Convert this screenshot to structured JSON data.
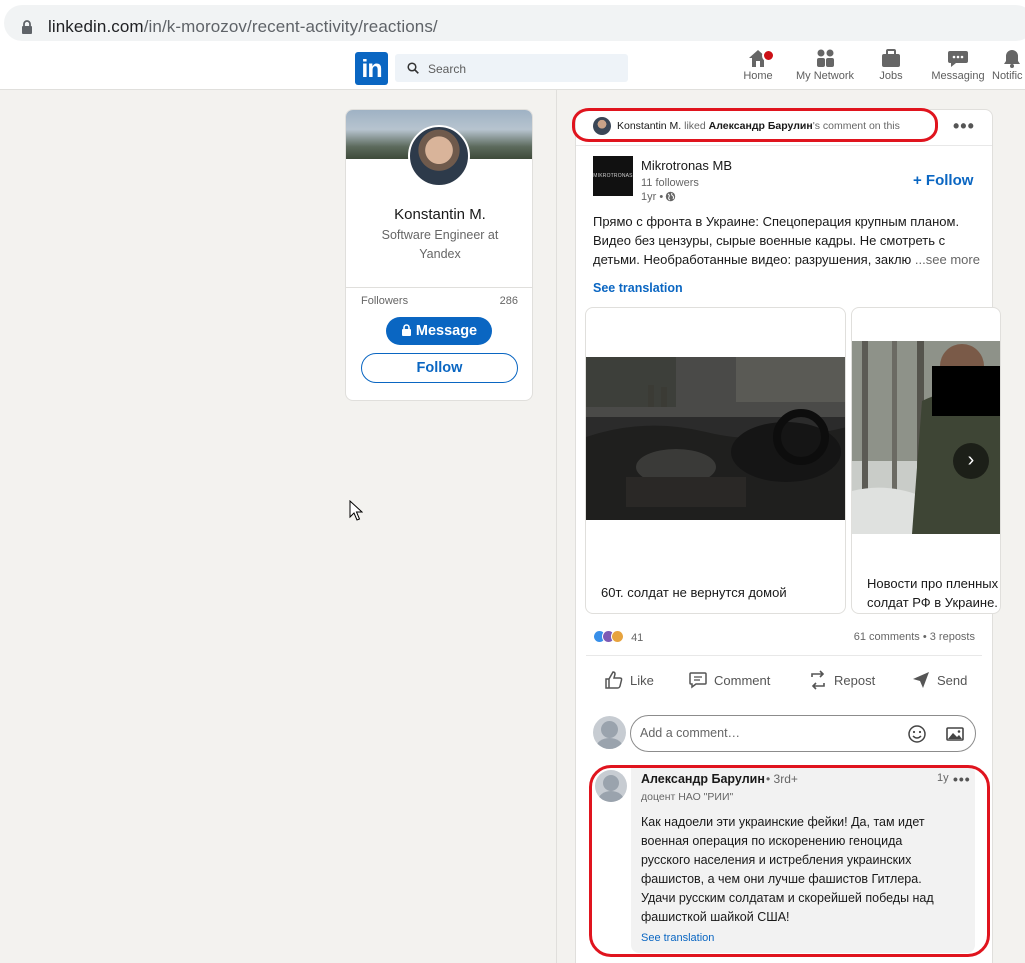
{
  "browser": {
    "url_host": "linkedin.com",
    "url_path": "/in/k-morozov/recent-activity/reactions/"
  },
  "nav": {
    "logo_text": "in",
    "search_placeholder": "Search",
    "items": [
      {
        "label": "Home",
        "icon": "home-icon"
      },
      {
        "label": "My Network",
        "icon": "network-icon"
      },
      {
        "label": "Jobs",
        "icon": "briefcase-icon"
      },
      {
        "label": "Messaging",
        "icon": "messaging-icon"
      },
      {
        "label": "Notific",
        "icon": "bell-icon"
      }
    ]
  },
  "profile": {
    "name": "Konstantin M.",
    "headline": "Software Engineer at Yandex",
    "followers_label": "Followers",
    "followers_count": "286",
    "message_label": "Message",
    "follow_label": "Follow"
  },
  "activity": {
    "actor": "Konstantin M.",
    "verb": " liked ",
    "target": "Александр Барулин",
    "suffix": "'s comment on this"
  },
  "post": {
    "company": "Mikrotronas MB",
    "logo_text": "MIKROTRONAS MB",
    "followers": "11 followers",
    "time": "1yr •",
    "follow_label": "+ Follow",
    "text_lines": [
      "Прямо с фронта в Украине: Спецоперация крупным планом.",
      "Видео без цензуры, сырые военные кадры. Не смотреть с",
      "детьми. Необработанные видео: разрушения, заклю"
    ],
    "see_more": "...see more",
    "see_translation": "See translation",
    "carousel": [
      {
        "caption": "60т. солдат не вернутся домой"
      },
      {
        "caption": "Новости про пленных солдат РФ в Украине."
      }
    ],
    "reactions_count": "41",
    "comments_reposts": "61 comments • 3 reposts",
    "actions": [
      "Like",
      "Comment",
      "Repost",
      "Send"
    ],
    "add_comment_placeholder": "Add a comment…"
  },
  "comment": {
    "author": "Александр Барулин",
    "degree": "• 3rd+",
    "time": "1y",
    "headline": "доцент НАО \"РИИ\"",
    "text_lines": [
      "Как надоели эти украинские фейки! Да, там идет",
      "военная операция по искоренению геноцида",
      "русского населения и истребления украинских",
      "фашистов, а чем они лучше фашистов Гитлера.",
      "Удачи русским солдатам и скорейшей победы над",
      "фашисткой шайкой США!"
    ],
    "see_translation": "See translation"
  },
  "colors": {
    "linkedin_blue": "#0a66c2",
    "highlight_red": "#e0141e",
    "notification_red": "#cc1016"
  }
}
